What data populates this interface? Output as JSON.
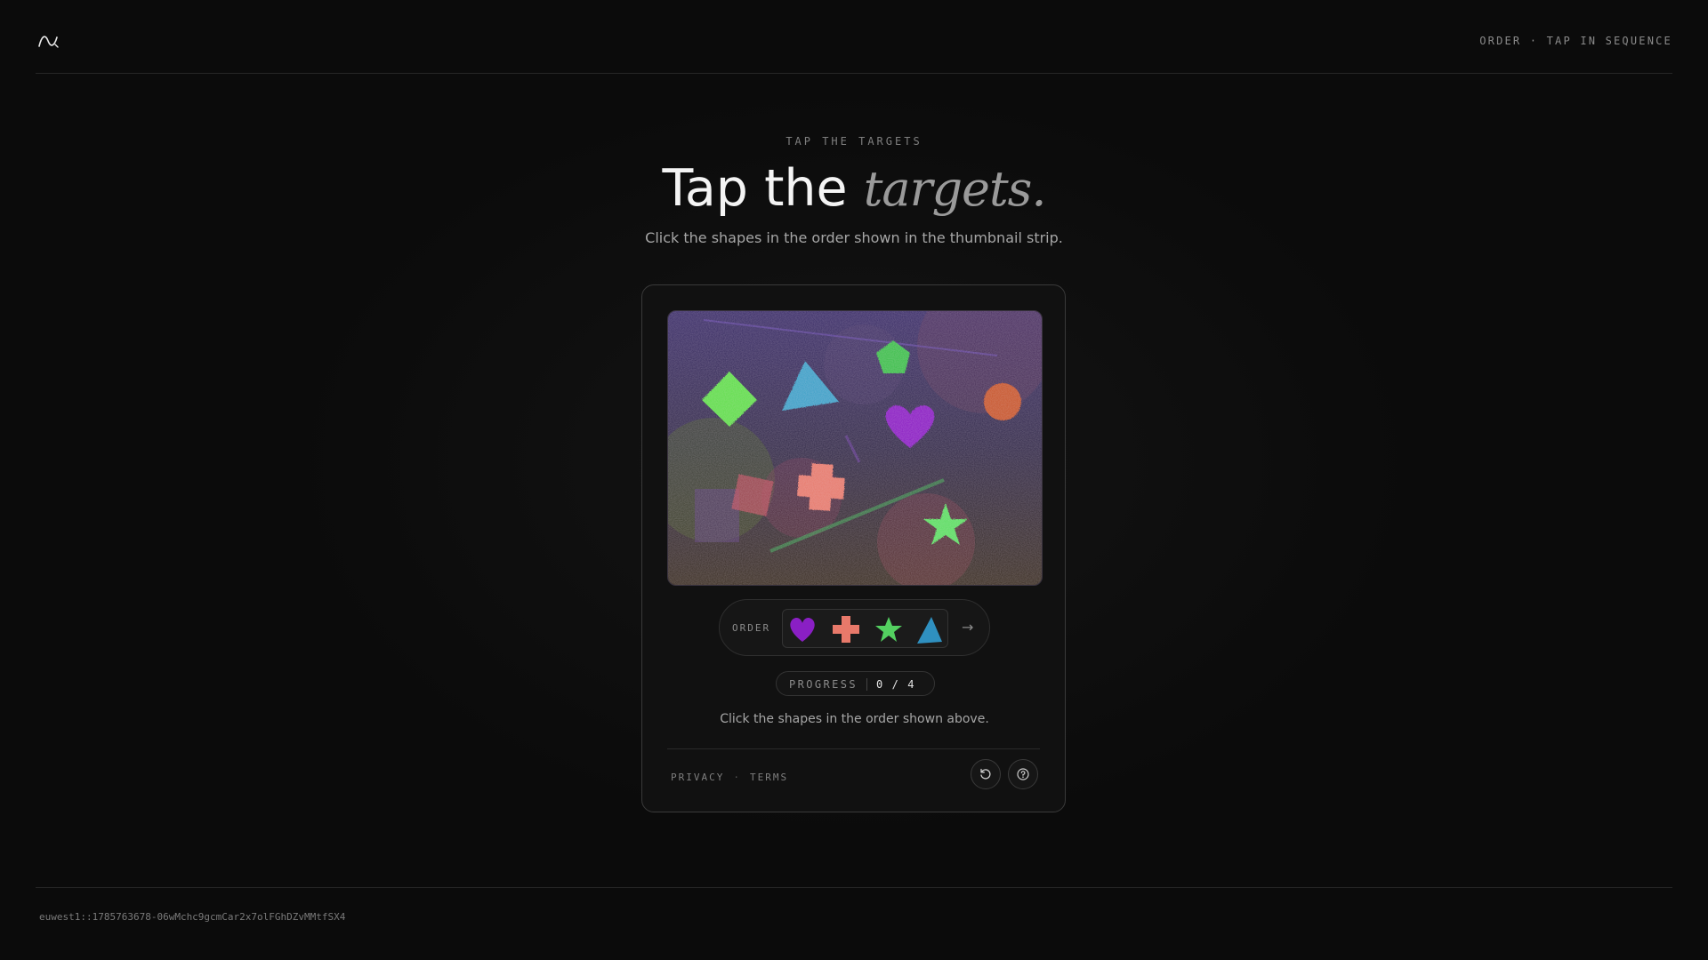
{
  "header": {
    "logo_icon": "wave-logo-icon",
    "right_text": "ORDER · TAP IN SEQUENCE"
  },
  "hero": {
    "eyebrow": "TAP THE TARGETS",
    "title_main": "Tap the ",
    "title_emphasis": "targets.",
    "subtitle": "Click the shapes in the order shown in the thumbnail strip."
  },
  "challenge": {
    "scene_shapes": [
      "diamond",
      "triangle",
      "pentagon",
      "heart",
      "circle",
      "cross",
      "star"
    ],
    "order": {
      "label": "ORDER",
      "thumbnails": [
        {
          "shape": "heart",
          "color": "#8a1fc4"
        },
        {
          "shape": "cross",
          "color": "#e8796a"
        },
        {
          "shape": "star",
          "color": "#53d060"
        },
        {
          "shape": "triangle",
          "color": "#2f90c0"
        }
      ],
      "next_icon": "arrow-right-icon"
    },
    "progress": {
      "label": "PROGRESS",
      "value": "0 / 4"
    },
    "hint": "Click the shapes in the order shown above.",
    "links": {
      "privacy": "PRIVACY",
      "separator": "·",
      "terms": "TERMS"
    },
    "buttons": {
      "reload_icon": "reload-icon",
      "help_icon": "help-icon"
    }
  },
  "footer": {
    "session_id": "euwest1::1785763678-06wMchc9gcmCar2x7olFGhDZvMMtfSX4"
  }
}
